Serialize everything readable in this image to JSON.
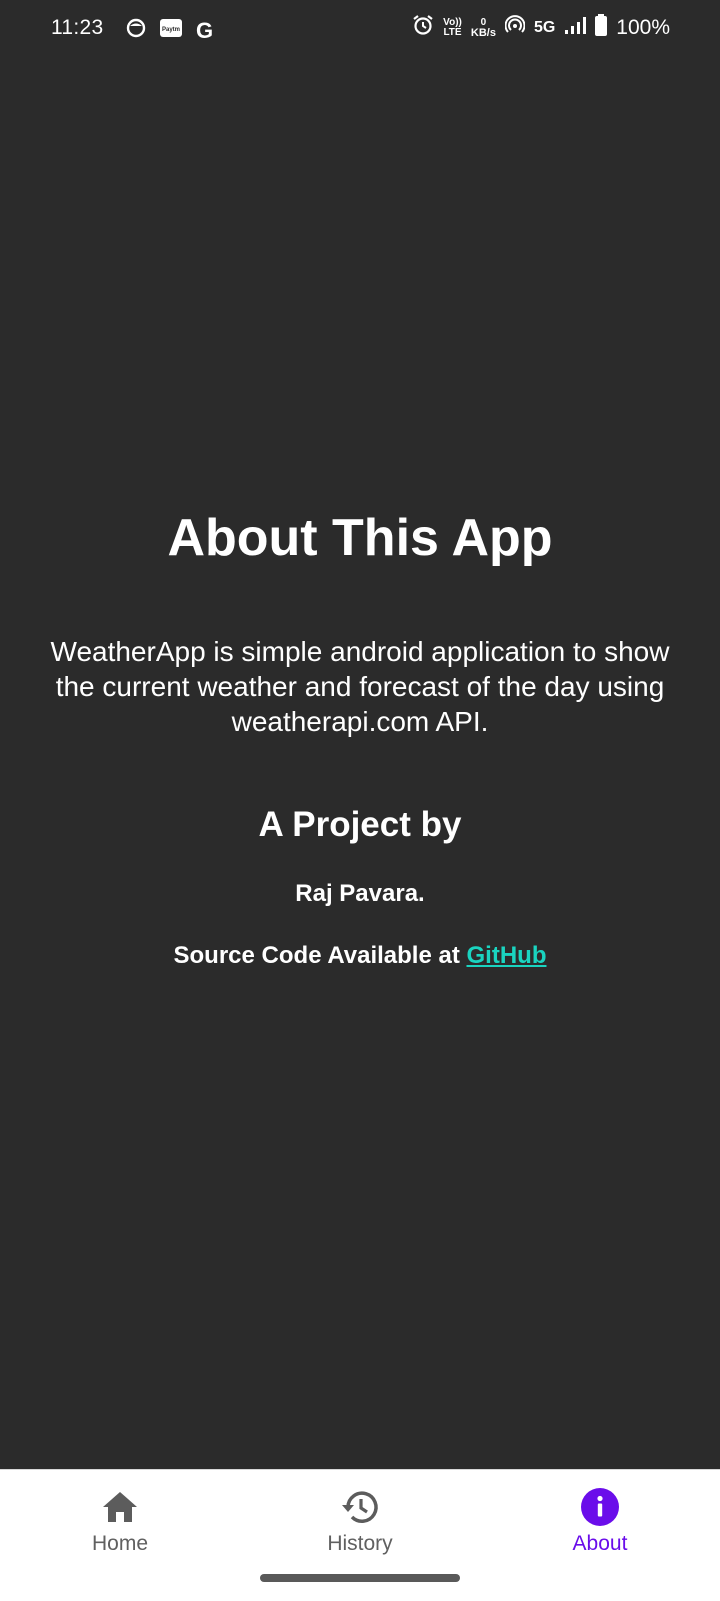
{
  "status_bar": {
    "time": "11:23",
    "icons_left": [
      "smiley-icon",
      "paytm-icon",
      "google-g-icon"
    ],
    "paytm_label": "Paytm",
    "google_label": "G",
    "volte_top": "Vo))",
    "volte_bottom": "LTE",
    "speed_value": "0",
    "speed_unit": "KB/s",
    "network": "5G",
    "battery": "100%"
  },
  "content": {
    "title": "About This App",
    "description": "WeatherApp is simple android application to show the current weather and forecast of the day using weatherapi.com API.",
    "project_heading": "A Project by",
    "author": "Raj Pavara.",
    "source_prefix": "Source Code Available at ",
    "source_link_label": "GitHub"
  },
  "bottom_nav": {
    "items": [
      {
        "label": "Home",
        "icon": "home-icon",
        "active": false
      },
      {
        "label": "History",
        "icon": "history-icon",
        "active": false
      },
      {
        "label": "About",
        "icon": "info-icon",
        "active": true
      }
    ]
  },
  "colors": {
    "background": "#2b2b2b",
    "link": "#1ad4c0",
    "nav_active": "#6a0dea",
    "nav_inactive": "#606060"
  }
}
